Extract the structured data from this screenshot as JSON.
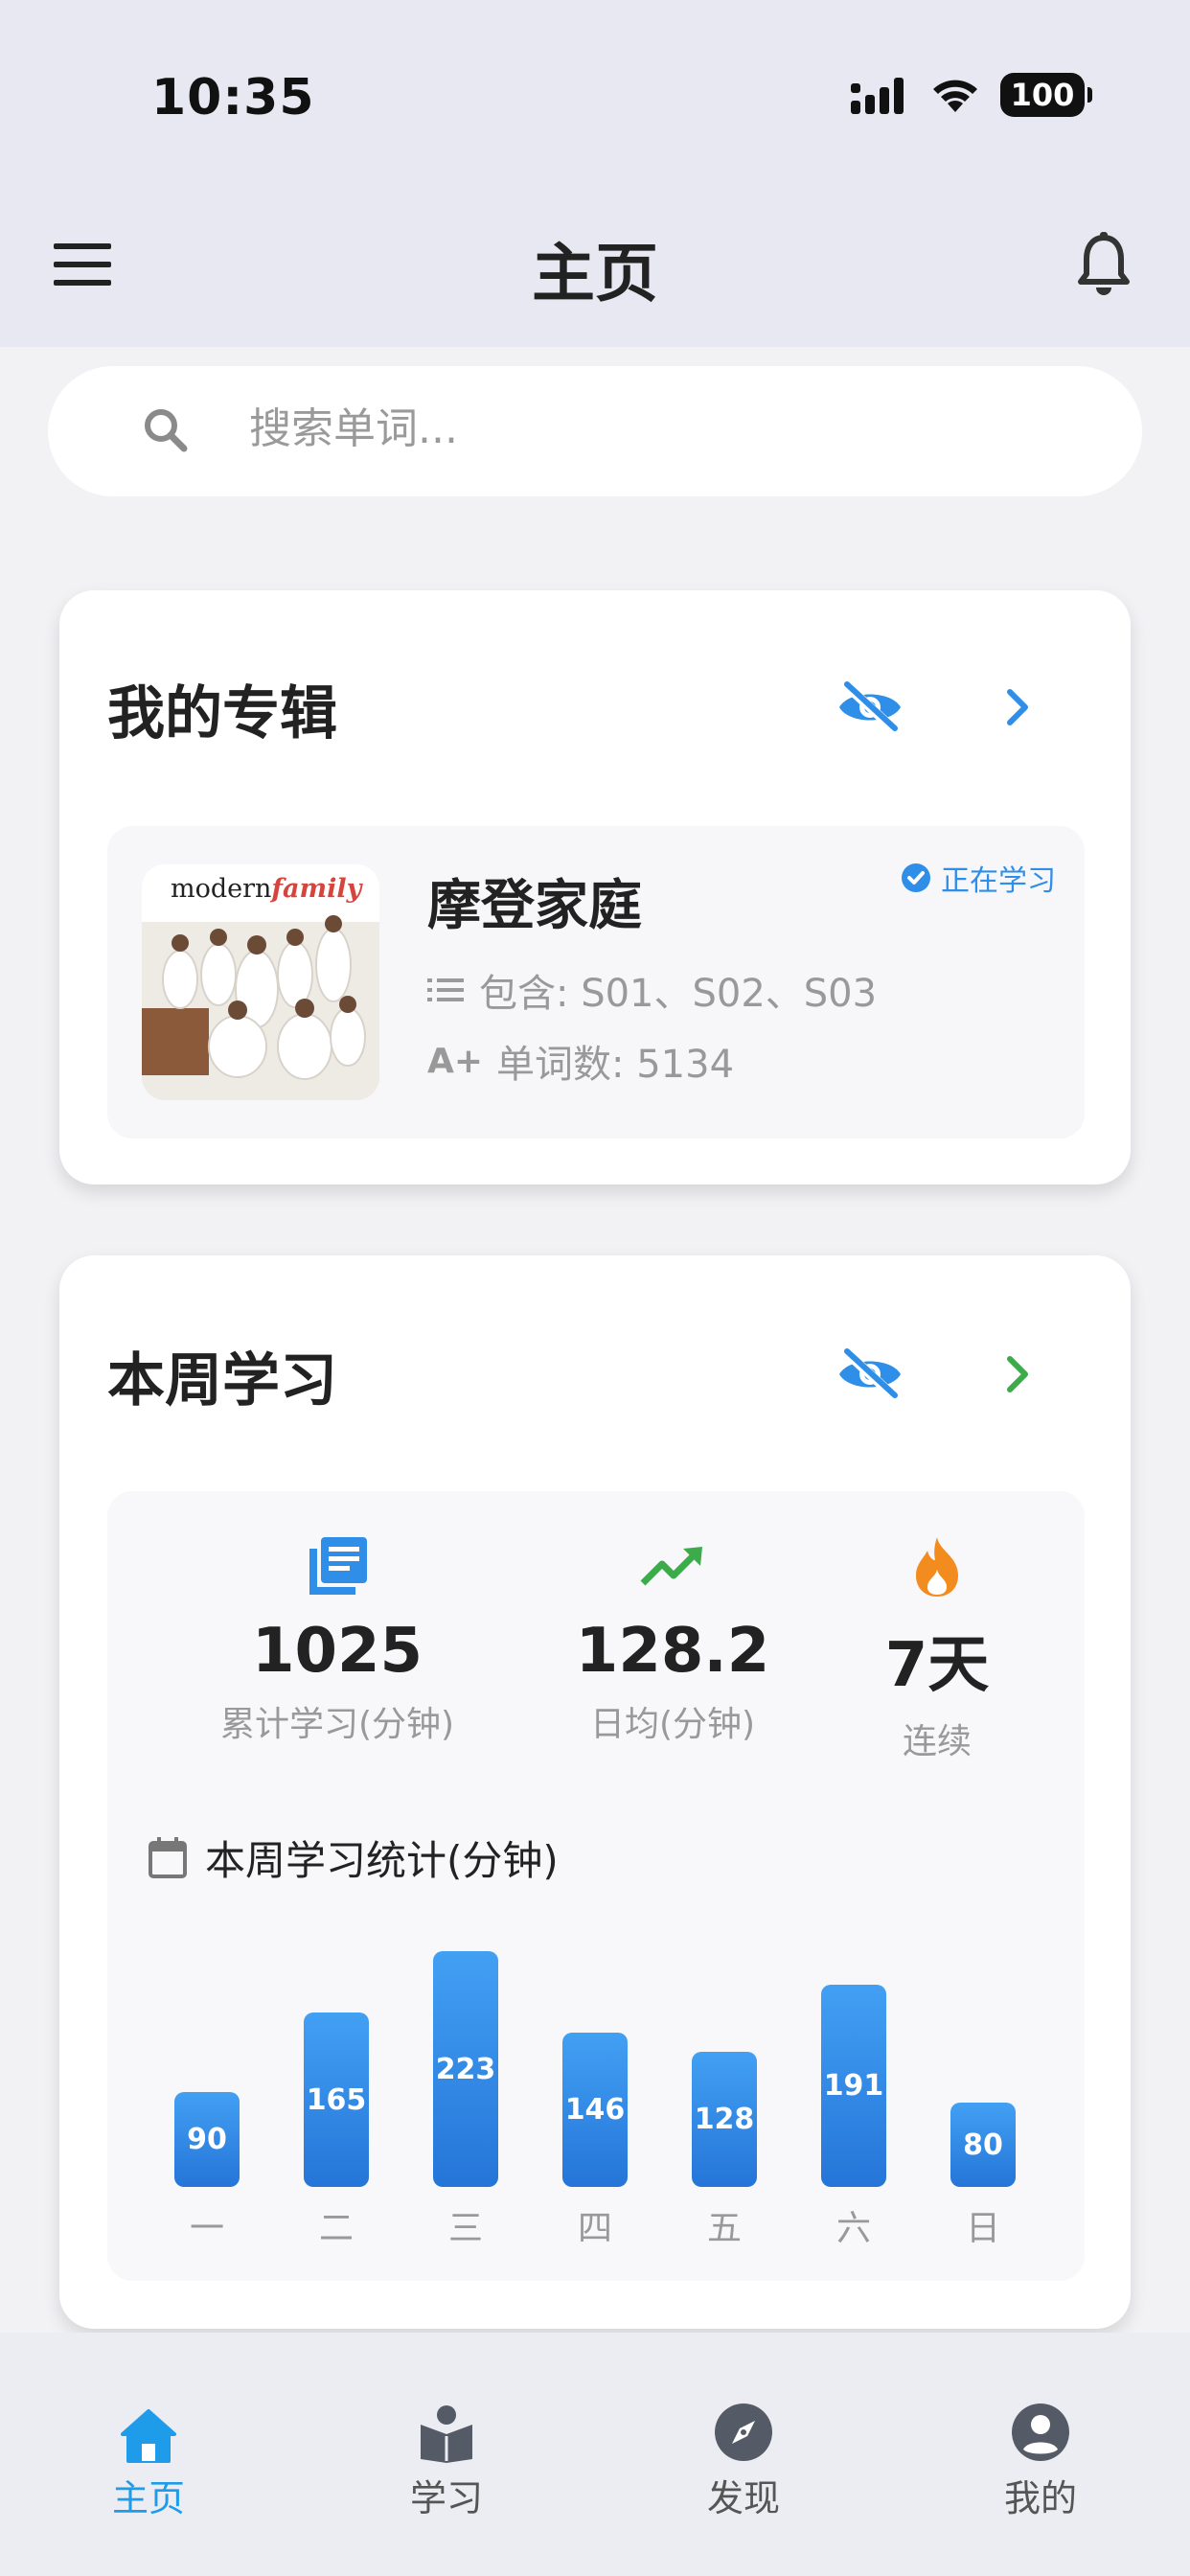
{
  "status_bar": {
    "time": "10:35",
    "battery": "100"
  },
  "header": {
    "title": "主页"
  },
  "search": {
    "placeholder": "搜索单词..."
  },
  "album_card": {
    "title": "我的专辑",
    "album": {
      "name": "摩登家庭",
      "poster_text_plain": "modern",
      "poster_text_accent": "family",
      "status": "正在学习",
      "seasons_line": "包含: S01、S02、S03",
      "words_line": "单词数: 5134",
      "words_prefix_icon": "A+"
    }
  },
  "week_card": {
    "title": "本周学习",
    "stats": [
      {
        "icon": "book-stack-icon",
        "value": "1025",
        "label": "累计学习(分钟)",
        "color": "#2f8fe8"
      },
      {
        "icon": "trending-up-icon",
        "value": "128.2",
        "label": "日均(分钟)",
        "color": "#3cab4a"
      },
      {
        "icon": "flame-icon",
        "value": "7天",
        "label": "连续",
        "color": "#f28c1e"
      }
    ],
    "chart_title": "本周学习统计(分钟)"
  },
  "chart_data": {
    "type": "bar",
    "title": "本周学习统计(分钟)",
    "categories": [
      "一",
      "二",
      "三",
      "四",
      "五",
      "六",
      "日"
    ],
    "values": [
      90,
      165,
      223,
      146,
      128,
      191,
      80
    ],
    "data_labels": true
  },
  "bottom_nav": {
    "items": [
      {
        "label": "主页",
        "icon": "home-icon",
        "active": true
      },
      {
        "label": "学习",
        "icon": "book-open-icon",
        "active": false
      },
      {
        "label": "发现",
        "icon": "compass-icon",
        "active": false
      },
      {
        "label": "我的",
        "icon": "user-circle-icon",
        "active": false
      }
    ]
  },
  "colors": {
    "accent_blue": "#2f8fe8",
    "accent_green": "#3cab4a",
    "nav_active": "#1e9be9"
  }
}
